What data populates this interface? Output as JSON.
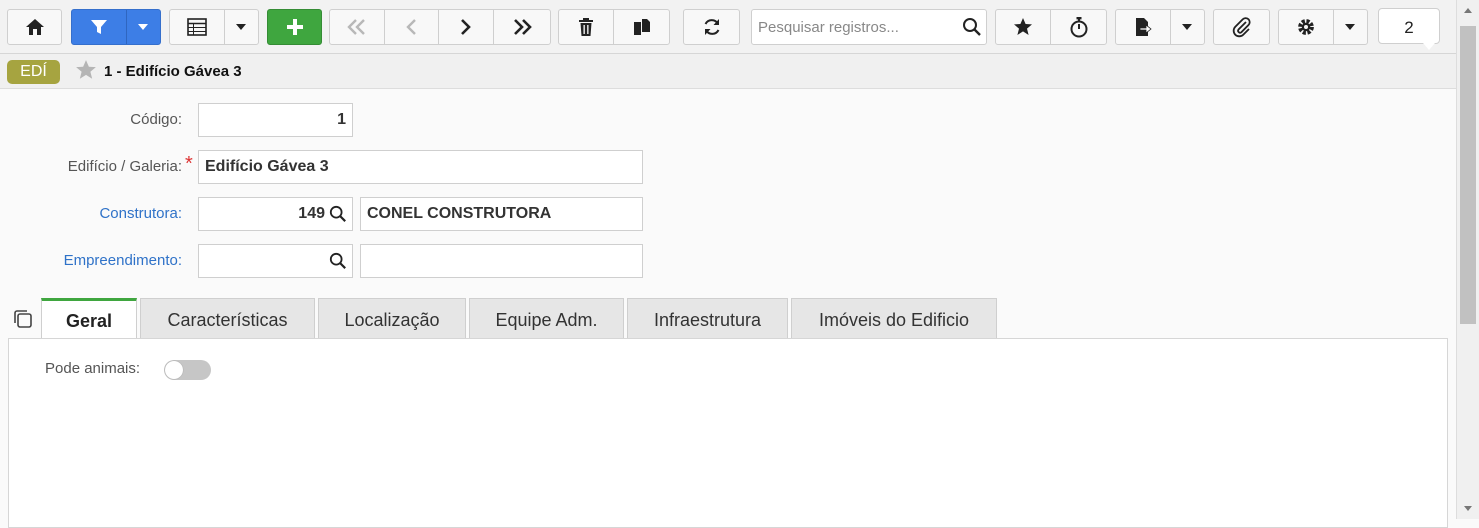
{
  "toolbar": {
    "search": {
      "placeholder": "Pesquisar registros..."
    },
    "notification_count": "2",
    "icons": [
      "home-icon",
      "filter-icon",
      "grid-icon",
      "plus-icon",
      "first-icon",
      "prev-icon",
      "next-icon",
      "last-icon",
      "trash-icon",
      "copy-icon",
      "refresh-icon",
      "search-icon",
      "star-icon",
      "timer-icon",
      "export-icon",
      "paperclip-icon",
      "gear-icon"
    ]
  },
  "record": {
    "badge": "EDÍ",
    "title": "1 - Edifício Gávea 3"
  },
  "form": {
    "codigo": {
      "label": "Código:",
      "value": "1"
    },
    "edificio": {
      "label": "Edifício / Galeria:",
      "value": "Edifício Gávea 3"
    },
    "construtora": {
      "label": "Construtora:",
      "code": "149",
      "name": "CONEL CONSTRUTORA"
    },
    "empreendimento": {
      "label": "Empreendimento:",
      "code": "",
      "name": ""
    }
  },
  "tabs": [
    {
      "label": "Geral"
    },
    {
      "label": "Características"
    },
    {
      "label": "Localização"
    },
    {
      "label": "Equipe Adm."
    },
    {
      "label": "Infraestrutura"
    },
    {
      "label": "Imóveis do Edificio"
    }
  ],
  "geral": {
    "pode_animais": {
      "label": "Pode animais:",
      "value": false
    }
  },
  "colors": {
    "accent_blue": "#3d7ee6",
    "accent_green": "#3fa63f",
    "badge": "#a6a440",
    "link": "#2f72c8"
  }
}
